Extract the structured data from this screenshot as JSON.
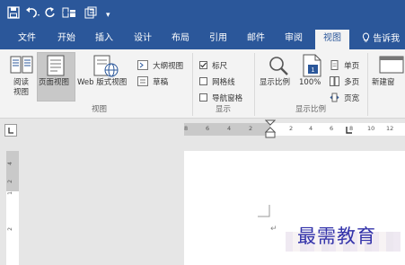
{
  "quick_access": {
    "save_icon": "save-icon",
    "undo_icon": "undo-icon",
    "redo_icon": "redo-icon",
    "touch_icon": "touch-mode-icon",
    "print_icon": "print-preview-icon",
    "customize": "▾"
  },
  "tabs": [
    {
      "label": "文件"
    },
    {
      "label": "开始"
    },
    {
      "label": "插入"
    },
    {
      "label": "设计"
    },
    {
      "label": "布局"
    },
    {
      "label": "引用"
    },
    {
      "label": "邮件"
    },
    {
      "label": "审阅"
    },
    {
      "label": "视图",
      "active": true
    }
  ],
  "tell_me": "告诉我",
  "ribbon": {
    "views": {
      "read_mode": "阅读\n视图",
      "print_layout": "页面视图",
      "web_layout": "Web 版式视图",
      "outline": "大纲视图",
      "draft": "草稿",
      "group": "视图"
    },
    "show": {
      "ruler": "标尺",
      "ruler_checked": true,
      "gridlines": "网格线",
      "gridlines_checked": false,
      "nav_pane": "导航窗格",
      "nav_pane_checked": false,
      "group": "显示"
    },
    "zoom": {
      "zoom": "显示比例",
      "hundred": "100%",
      "one_page": "单页",
      "multi_page": "多页",
      "page_width": "页宽",
      "group": "显示比例"
    },
    "window": {
      "new_window": "新建窗"
    }
  },
  "ruler": {
    "left_marks": [
      "8",
      "6",
      "4",
      "2"
    ],
    "right_marks": [
      "2",
      "4",
      "6",
      "8",
      "10",
      "12"
    ],
    "vertical_marks": [
      "4",
      "2",
      "1",
      "2"
    ]
  },
  "watermark": "最需教育",
  "colors": {
    "brand": "#2b579a",
    "ribbon": "#f3f3f3",
    "watermark": "#3333aa"
  }
}
